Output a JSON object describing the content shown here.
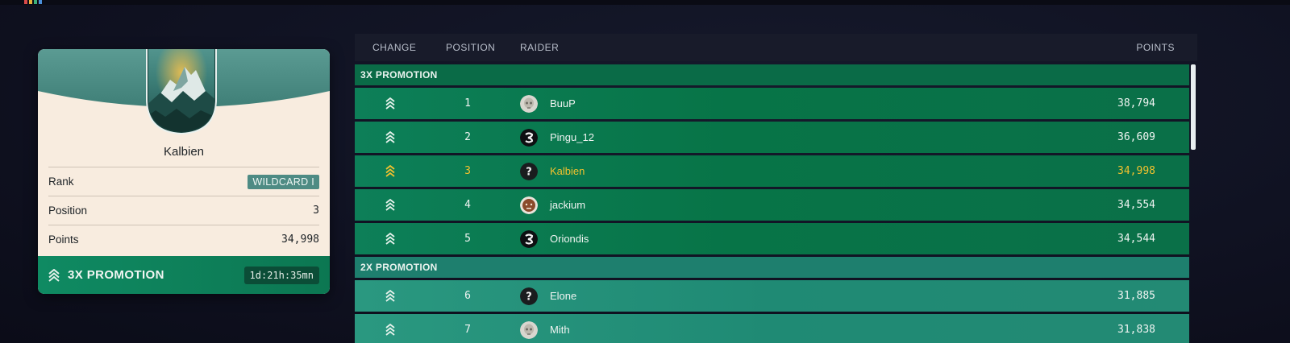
{
  "profile": {
    "name": "Kalbien",
    "rank_label": "Rank",
    "rank_value": "WILDCARD I",
    "position_label": "Position",
    "position_value": "3",
    "points_label": "Points",
    "points_value": "34,998",
    "promotion_label": "3X PROMOTION",
    "timer": "1d:21h:35mn",
    "crest_icon": "mountain-crest-icon"
  },
  "leaderboard": {
    "columns": {
      "change": "CHANGE",
      "position": "POSITION",
      "raider": "RAIDER",
      "points": "POINTS"
    },
    "sections": [
      {
        "label": "3X PROMOTION",
        "rows": [
          {
            "position": "1",
            "name": "BuuP",
            "points": "38,794",
            "avatar": "skull-avatar"
          },
          {
            "position": "2",
            "name": "Pingu_12",
            "points": "36,609",
            "avatar": "dark-logo-avatar"
          },
          {
            "position": "3",
            "name": "Kalbien",
            "points": "34,998",
            "avatar": "unknown-avatar",
            "highlighted": true
          },
          {
            "position": "4",
            "name": "jackium",
            "points": "34,554",
            "avatar": "face-avatar"
          },
          {
            "position": "5",
            "name": "Oriondis",
            "points": "34,544",
            "avatar": "dark-logo-avatar"
          }
        ]
      },
      {
        "label": "2X PROMOTION",
        "rows": [
          {
            "position": "6",
            "name": "Elone",
            "points": "31,885",
            "avatar": "unknown-avatar"
          },
          {
            "position": "7",
            "name": "Mith",
            "points": "31,838",
            "avatar": "skull-avatar"
          }
        ]
      }
    ]
  },
  "colors": {
    "highlight": "#f2c12e",
    "promo3x": "#0a6b47",
    "promo2x": "#1e7f6e"
  }
}
